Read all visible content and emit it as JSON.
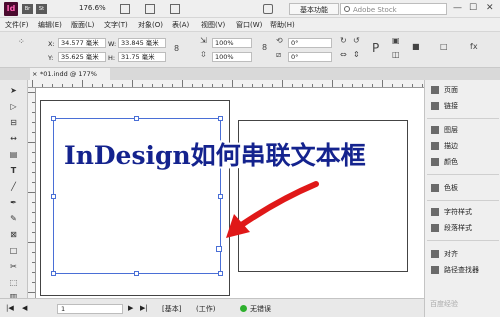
{
  "app": {
    "logo": "Id",
    "bridge": "Br",
    "stock": "St",
    "zoom": "176.6%",
    "workspace": "基本功能",
    "search_placeholder": "Adobe Stock",
    "win_min": "—",
    "win_max": "☐",
    "win_close": "✕"
  },
  "menu": [
    "文件(F)",
    "编辑(E)",
    "版面(L)",
    "文字(T)",
    "对象(O)",
    "表(A)",
    "视图(V)",
    "窗口(W)",
    "帮助(H)"
  ],
  "control": {
    "x_label": "X:",
    "x_value": "34.577 毫米",
    "y_label": "Y:",
    "y_value": "35.625 毫米",
    "w_label": "W:",
    "w_value": "33.845 毫米",
    "h_label": "H:",
    "h_value": "31.75 毫米",
    "scale_x": "100%",
    "scale_y": "100%",
    "rotate": "0°",
    "shear": "0°"
  },
  "doc_tab": {
    "close": "×",
    "title": "*01.indd @ 177%"
  },
  "status": {
    "page": "1",
    "master": "[基本]",
    "mode": "(工作)",
    "errors": "无错误"
  },
  "panels": [
    {
      "label": "页面",
      "icon": "pages-icon"
    },
    {
      "label": "链接",
      "icon": "links-icon"
    },
    {
      "label": "图层",
      "icon": "layers-icon"
    },
    {
      "label": "描边",
      "icon": "stroke-icon"
    },
    {
      "label": "颜色",
      "icon": "color-icon"
    },
    {
      "label": "色板",
      "icon": "swatches-icon"
    },
    {
      "label": "字符样式",
      "icon": "character-styles-icon"
    },
    {
      "label": "段落样式",
      "icon": "paragraph-styles-icon"
    },
    {
      "label": "对齐",
      "icon": "align-icon"
    },
    {
      "label": "路径查找器",
      "icon": "pathfinder-icon"
    }
  ],
  "overlay_title": "InDesign如何串联文本框",
  "watermark": "百度经验",
  "colors": {
    "overlay_text": "#14238e",
    "arrow": "#e01818",
    "frame": "#4a6fd6"
  }
}
